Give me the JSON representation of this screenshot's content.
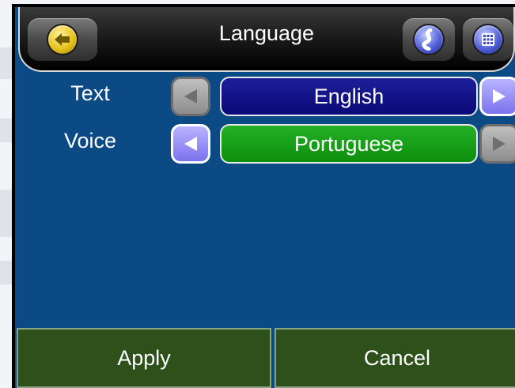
{
  "header": {
    "title": "Language",
    "back_icon": "back-arrow-icon",
    "route_icon": "route-icon",
    "menu_icon": "keypad-menu-icon"
  },
  "settings": [
    {
      "label": "Text",
      "value": "English",
      "box_color": "#0a0a78",
      "left_enabled": false,
      "right_enabled": true
    },
    {
      "label": "Voice",
      "value": "Portuguese",
      "box_color": "#12981a",
      "left_enabled": true,
      "right_enabled": false
    }
  ],
  "footer": {
    "apply_label": "Apply",
    "cancel_label": "Cancel"
  },
  "colors": {
    "screen_bg": "#0b4a85",
    "footer_bg": "#2e511c",
    "arrow_enabled": "#7b72ee",
    "arrow_disabled": "#8d8d8d"
  }
}
